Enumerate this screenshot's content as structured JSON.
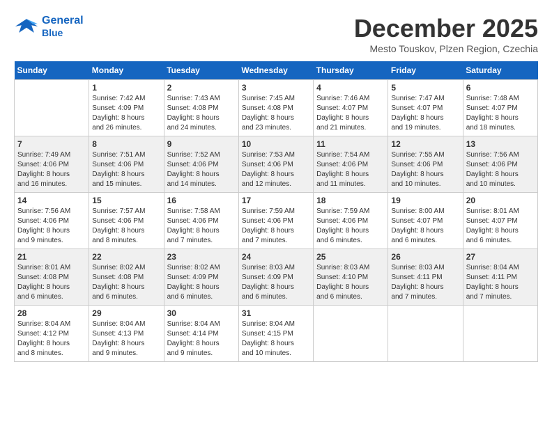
{
  "header": {
    "logo_line1": "General",
    "logo_line2": "Blue",
    "month": "December 2025",
    "location": "Mesto Touskov, Plzen Region, Czechia"
  },
  "weekdays": [
    "Sunday",
    "Monday",
    "Tuesday",
    "Wednesday",
    "Thursday",
    "Friday",
    "Saturday"
  ],
  "weeks": [
    [
      {
        "day": "",
        "info": ""
      },
      {
        "day": "1",
        "info": "Sunrise: 7:42 AM\nSunset: 4:09 PM\nDaylight: 8 hours\nand 26 minutes."
      },
      {
        "day": "2",
        "info": "Sunrise: 7:43 AM\nSunset: 4:08 PM\nDaylight: 8 hours\nand 24 minutes."
      },
      {
        "day": "3",
        "info": "Sunrise: 7:45 AM\nSunset: 4:08 PM\nDaylight: 8 hours\nand 23 minutes."
      },
      {
        "day": "4",
        "info": "Sunrise: 7:46 AM\nSunset: 4:07 PM\nDaylight: 8 hours\nand 21 minutes."
      },
      {
        "day": "5",
        "info": "Sunrise: 7:47 AM\nSunset: 4:07 PM\nDaylight: 8 hours\nand 19 minutes."
      },
      {
        "day": "6",
        "info": "Sunrise: 7:48 AM\nSunset: 4:07 PM\nDaylight: 8 hours\nand 18 minutes."
      }
    ],
    [
      {
        "day": "7",
        "info": "Sunrise: 7:49 AM\nSunset: 4:06 PM\nDaylight: 8 hours\nand 16 minutes."
      },
      {
        "day": "8",
        "info": "Sunrise: 7:51 AM\nSunset: 4:06 PM\nDaylight: 8 hours\nand 15 minutes."
      },
      {
        "day": "9",
        "info": "Sunrise: 7:52 AM\nSunset: 4:06 PM\nDaylight: 8 hours\nand 14 minutes."
      },
      {
        "day": "10",
        "info": "Sunrise: 7:53 AM\nSunset: 4:06 PM\nDaylight: 8 hours\nand 12 minutes."
      },
      {
        "day": "11",
        "info": "Sunrise: 7:54 AM\nSunset: 4:06 PM\nDaylight: 8 hours\nand 11 minutes."
      },
      {
        "day": "12",
        "info": "Sunrise: 7:55 AM\nSunset: 4:06 PM\nDaylight: 8 hours\nand 10 minutes."
      },
      {
        "day": "13",
        "info": "Sunrise: 7:56 AM\nSunset: 4:06 PM\nDaylight: 8 hours\nand 10 minutes."
      }
    ],
    [
      {
        "day": "14",
        "info": "Sunrise: 7:56 AM\nSunset: 4:06 PM\nDaylight: 8 hours\nand 9 minutes."
      },
      {
        "day": "15",
        "info": "Sunrise: 7:57 AM\nSunset: 4:06 PM\nDaylight: 8 hours\nand 8 minutes."
      },
      {
        "day": "16",
        "info": "Sunrise: 7:58 AM\nSunset: 4:06 PM\nDaylight: 8 hours\nand 7 minutes."
      },
      {
        "day": "17",
        "info": "Sunrise: 7:59 AM\nSunset: 4:06 PM\nDaylight: 8 hours\nand 7 minutes."
      },
      {
        "day": "18",
        "info": "Sunrise: 7:59 AM\nSunset: 4:06 PM\nDaylight: 8 hours\nand 6 minutes."
      },
      {
        "day": "19",
        "info": "Sunrise: 8:00 AM\nSunset: 4:07 PM\nDaylight: 8 hours\nand 6 minutes."
      },
      {
        "day": "20",
        "info": "Sunrise: 8:01 AM\nSunset: 4:07 PM\nDaylight: 8 hours\nand 6 minutes."
      }
    ],
    [
      {
        "day": "21",
        "info": "Sunrise: 8:01 AM\nSunset: 4:08 PM\nDaylight: 8 hours\nand 6 minutes."
      },
      {
        "day": "22",
        "info": "Sunrise: 8:02 AM\nSunset: 4:08 PM\nDaylight: 8 hours\nand 6 minutes."
      },
      {
        "day": "23",
        "info": "Sunrise: 8:02 AM\nSunset: 4:09 PM\nDaylight: 8 hours\nand 6 minutes."
      },
      {
        "day": "24",
        "info": "Sunrise: 8:03 AM\nSunset: 4:09 PM\nDaylight: 8 hours\nand 6 minutes."
      },
      {
        "day": "25",
        "info": "Sunrise: 8:03 AM\nSunset: 4:10 PM\nDaylight: 8 hours\nand 6 minutes."
      },
      {
        "day": "26",
        "info": "Sunrise: 8:03 AM\nSunset: 4:11 PM\nDaylight: 8 hours\nand 7 minutes."
      },
      {
        "day": "27",
        "info": "Sunrise: 8:04 AM\nSunset: 4:11 PM\nDaylight: 8 hours\nand 7 minutes."
      }
    ],
    [
      {
        "day": "28",
        "info": "Sunrise: 8:04 AM\nSunset: 4:12 PM\nDaylight: 8 hours\nand 8 minutes."
      },
      {
        "day": "29",
        "info": "Sunrise: 8:04 AM\nSunset: 4:13 PM\nDaylight: 8 hours\nand 9 minutes."
      },
      {
        "day": "30",
        "info": "Sunrise: 8:04 AM\nSunset: 4:14 PM\nDaylight: 8 hours\nand 9 minutes."
      },
      {
        "day": "31",
        "info": "Sunrise: 8:04 AM\nSunset: 4:15 PM\nDaylight: 8 hours\nand 10 minutes."
      },
      {
        "day": "",
        "info": ""
      },
      {
        "day": "",
        "info": ""
      },
      {
        "day": "",
        "info": ""
      }
    ]
  ]
}
